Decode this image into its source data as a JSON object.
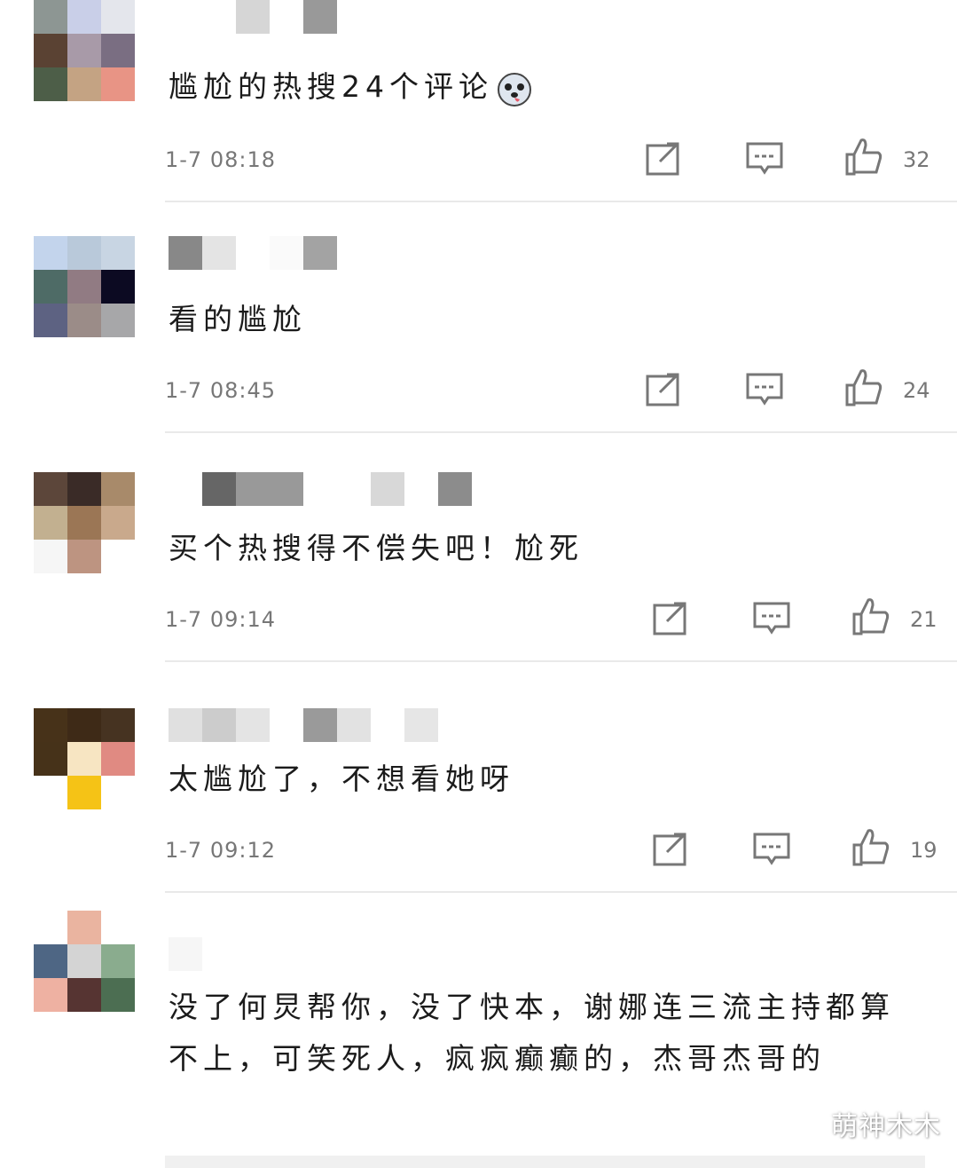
{
  "comments": [
    {
      "text": "尴尬的热搜24个评论",
      "time": "1-7 08:18",
      "likes": "32",
      "avatar_colors": [
        "#8d9693",
        "#c9cfe8",
        "#e4e6ec",
        "#5a4233",
        "#a89aa8",
        "#7a6e82",
        "#4d5e48",
        "#c4a383",
        "#e89485"
      ],
      "name_blocks": [
        "#ffffff",
        "#ffffff",
        "#d6d6d6",
        "#ffffff",
        "#999999"
      ],
      "has_emoji": true
    },
    {
      "text": "看的尴尬",
      "time": "1-7 08:45",
      "likes": "24",
      "avatar_colors": [
        "#c3d4ec",
        "#b9c9da",
        "#c8d5e3",
        "#4e6b66",
        "#917b83",
        "#0c0a22",
        "#5d6282",
        "#9b8c88",
        "#a7a7a9"
      ],
      "name_blocks": [
        "#888888",
        "#e4e4e4",
        "#ffffff",
        "#fafafa",
        "#a3a3a3"
      ],
      "has_emoji": false
    },
    {
      "text": "买个热搜得不偿失吧！尬死",
      "time": "1-7 09:14",
      "likes": "21",
      "avatar_colors": [
        "#5c463a",
        "#3a2b27",
        "#a88a6a",
        "#c2b090",
        "#9b7655",
        "#c9a98c",
        "#f6f6f6",
        "#bd9481",
        "#ffffff"
      ],
      "name_blocks": [
        "#ffffff",
        "#666666",
        "#999999",
        "#999999",
        "#ffffff",
        "#ffffff",
        "#d8d8d8",
        "#ffffff",
        "#8c8c8c"
      ],
      "has_emoji": false
    },
    {
      "text": "太尴尬了，不想看她呀",
      "time": "1-7 09:12",
      "likes": "19",
      "avatar_colors": [
        "#473219",
        "#3e2a17",
        "#463321",
        "#463219",
        "#f7e5c2",
        "#e08a82",
        "#ffffff",
        "#f5c316",
        "#ffffff"
      ],
      "name_blocks": [
        "#e0e0e0",
        "#cccccc",
        "#e4e4e4",
        "#ffffff",
        "#9a9a9a",
        "#e2e2e2",
        "#ffffff",
        "#e6e6e6"
      ],
      "has_emoji": false
    },
    {
      "text": "没了何炅帮你，没了快本，谢娜连三流主持都算不上，可笑死人，疯疯癫癫的，杰哥杰哥的",
      "avatar_colors": [
        "#ffffff",
        "#eab4a0",
        "#ffffff",
        "#4e6684",
        "#d4d4d4",
        "#8aac8e",
        "#eeb1a2",
        "#563432",
        "#4c6e52"
      ],
      "name_blocks": [
        "#f6f6f6",
        "#ffffff",
        "#ffffff"
      ],
      "has_emoji": false
    }
  ],
  "watermark": "萌神木木"
}
